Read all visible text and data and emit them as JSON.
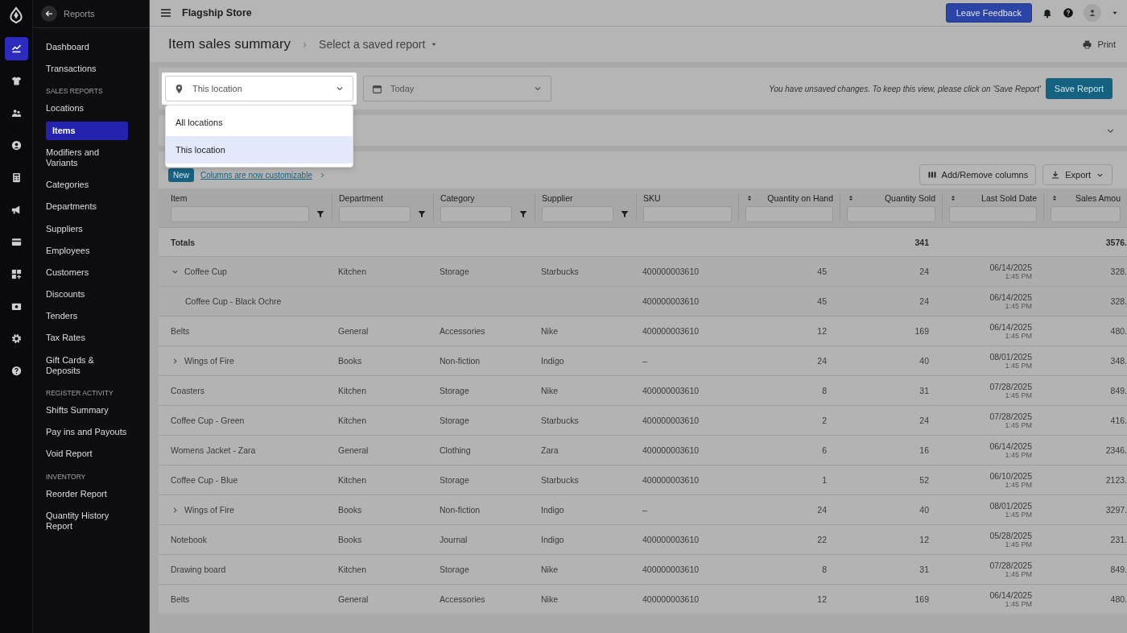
{
  "rail": [
    {
      "kind": "logo",
      "selected": false
    },
    {
      "kind": "chart",
      "selected": true
    },
    {
      "kind": "shirt",
      "selected": false
    },
    {
      "kind": "people",
      "selected": false
    },
    {
      "kind": "person",
      "selected": false
    },
    {
      "kind": "register",
      "selected": false
    },
    {
      "kind": "megaphone",
      "selected": false
    },
    {
      "kind": "card",
      "selected": false
    },
    {
      "kind": "apps",
      "selected": false
    },
    {
      "kind": "cash",
      "selected": false
    },
    {
      "kind": "settings",
      "selected": false
    },
    {
      "kind": "help",
      "selected": false
    }
  ],
  "nav": {
    "back_label": "Reports",
    "items": [
      {
        "kind": "link",
        "label": "Dashboard",
        "selected": false
      },
      {
        "kind": "link",
        "label": "Transactions",
        "selected": false
      },
      {
        "kind": "heading",
        "label": "SALES REPORTS"
      },
      {
        "kind": "link",
        "label": "Locations",
        "selected": false
      },
      {
        "kind": "link",
        "label": "Items",
        "selected": true
      },
      {
        "kind": "link",
        "label": "Modifiers and Variants",
        "selected": false
      },
      {
        "kind": "link",
        "label": "Categories",
        "selected": false
      },
      {
        "kind": "link",
        "label": "Departments",
        "selected": false
      },
      {
        "kind": "link",
        "label": "Suppliers",
        "selected": false
      },
      {
        "kind": "link",
        "label": "Employees",
        "selected": false
      },
      {
        "kind": "link",
        "label": "Customers",
        "selected": false
      },
      {
        "kind": "link",
        "label": "Discounts",
        "selected": false
      },
      {
        "kind": "link",
        "label": "Tenders",
        "selected": false
      },
      {
        "kind": "link",
        "label": "Tax Rates",
        "selected": false
      },
      {
        "kind": "link",
        "label": "Gift Cards & Deposits",
        "selected": false
      },
      {
        "kind": "heading",
        "label": "REGISTER ACTIVITY"
      },
      {
        "kind": "link",
        "label": "Shifts Summary",
        "selected": false
      },
      {
        "kind": "link",
        "label": "Pay ins and Payouts",
        "selected": false
      },
      {
        "kind": "link",
        "label": "Void Report",
        "selected": false
      },
      {
        "kind": "heading",
        "label": "INVENTORY"
      },
      {
        "kind": "link",
        "label": "Reorder Report",
        "selected": false
      },
      {
        "kind": "link",
        "label": "Quantity History Report",
        "selected": false
      }
    ]
  },
  "topbar": {
    "store": "Flagship Store",
    "feedback_button": "Leave Feedback"
  },
  "header": {
    "title": "Item sales summary",
    "saved_report": "Select a saved report",
    "print": "Print"
  },
  "filters": {
    "location": "This location",
    "location_options": [
      {
        "label": "All locations",
        "selected": false
      },
      {
        "label": "This location",
        "selected": true
      }
    ],
    "date": "Today",
    "unsaved_note": "You have unsaved changes. To keep this view, please click on 'Save Report'",
    "save_button": "Save Report"
  },
  "table_toolbar": {
    "badge": "New",
    "link": "Columns are now customizable",
    "columns_button": "Add/Remove columns",
    "export_button": "Export"
  },
  "table": {
    "columns": [
      {
        "label": "Item",
        "kind": "filter"
      },
      {
        "label": "Department",
        "kind": "filter"
      },
      {
        "label": "Category",
        "kind": "filter"
      },
      {
        "label": "Supplier",
        "kind": "filter"
      },
      {
        "label": "SKU",
        "kind": "plain"
      },
      {
        "label": "Quantity on Hand",
        "kind": "sort"
      },
      {
        "label": "Quantity Sold",
        "kind": "sort"
      },
      {
        "label": "Last Sold Date",
        "kind": "sort"
      },
      {
        "label": "Sales Amou",
        "kind": "sort"
      }
    ],
    "totals": {
      "label": "Totals",
      "qty_sold": "341",
      "sales_amount": "3576."
    },
    "rows": [
      {
        "kind": "parent",
        "expanded": true,
        "item": "Coffee Cup",
        "department": "Kitchen",
        "category": "Storage",
        "supplier": "Starbucks",
        "sku": "400000003610",
        "qty_on_hand": "45",
        "qty_sold": "24",
        "date": "06/14/2025",
        "time": "1:45 PM",
        "sales_amount": "328."
      },
      {
        "kind": "child",
        "item": "Coffee Cup - Black Ochre",
        "sku": "400000003610",
        "qty_on_hand": "45",
        "qty_sold": "24",
        "date": "06/14/2025",
        "time": "1:45 PM",
        "sales_amount": "328."
      },
      {
        "kind": "plain",
        "item": "Belts",
        "department": "General",
        "category": "Accessories",
        "supplier": "Nike",
        "sku": "400000003610",
        "qty_on_hand": "12",
        "qty_sold": "169",
        "date": "06/14/2025",
        "time": "1:45 PM",
        "sales_amount": "480."
      },
      {
        "kind": "parent",
        "expanded": false,
        "item": "Wings of Fire",
        "department": "Books",
        "category": "Non-fiction",
        "supplier": "Indigo",
        "sku": "–",
        "qty_on_hand": "24",
        "qty_sold": "40",
        "date": "08/01/2025",
        "time": "1:45 PM",
        "sales_amount": "348."
      },
      {
        "kind": "plain",
        "item": "Coasters",
        "department": "Kitchen",
        "category": "Storage",
        "supplier": "Nike",
        "sku": "400000003610",
        "qty_on_hand": "8",
        "qty_sold": "31",
        "date": "07/28/2025",
        "time": "1:45 PM",
        "sales_amount": "849."
      },
      {
        "kind": "plain",
        "item": "Coffee Cup - Green",
        "department": "Kitchen",
        "category": "Storage",
        "supplier": "Starbucks",
        "sku": "400000003610",
        "qty_on_hand": "2",
        "qty_sold": "24",
        "date": "07/28/2025",
        "time": "1:45 PM",
        "sales_amount": "416."
      },
      {
        "kind": "plain",
        "item": "Womens Jacket - Zara",
        "department": "General",
        "category": "Clothing",
        "supplier": "Zara",
        "sku": "400000003610",
        "qty_on_hand": "6",
        "qty_sold": "16",
        "date": "06/14/2025",
        "time": "1:45 PM",
        "sales_amount": "2346."
      },
      {
        "kind": "plain",
        "item": "Coffee Cup - Blue",
        "department": "Kitchen",
        "category": "Storage",
        "supplier": "Starbucks",
        "sku": "400000003610",
        "qty_on_hand": "1",
        "qty_sold": "52",
        "date": "06/10/2025",
        "time": "1:45 PM",
        "sales_amount": "2123."
      },
      {
        "kind": "parent",
        "expanded": false,
        "item": "Wings of Fire",
        "department": "Books",
        "category": "Non-fiction",
        "supplier": "Indigo",
        "sku": "–",
        "qty_on_hand": "24",
        "qty_sold": "40",
        "date": "08/01/2025",
        "time": "1:45 PM",
        "sales_amount": "3297."
      },
      {
        "kind": "plain",
        "item": "Notebook",
        "department": "Books",
        "category": "Journal",
        "supplier": "Indigo",
        "sku": "400000003610",
        "qty_on_hand": "22",
        "qty_sold": "12",
        "date": "05/28/2025",
        "time": "1:45 PM",
        "sales_amount": "231."
      },
      {
        "kind": "plain",
        "item": "Drawing board",
        "department": "Kitchen",
        "category": "Storage",
        "supplier": "Nike",
        "sku": "400000003610",
        "qty_on_hand": "8",
        "qty_sold": "31",
        "date": "07/28/2025",
        "time": "1:45 PM",
        "sales_amount": "849."
      },
      {
        "kind": "plain",
        "item": "Belts",
        "department": "General",
        "category": "Accessories",
        "supplier": "Nike",
        "sku": "400000003610",
        "qty_on_hand": "12",
        "qty_sold": "169",
        "date": "06/14/2025",
        "time": "1:45 PM",
        "sales_amount": "480."
      }
    ]
  }
}
